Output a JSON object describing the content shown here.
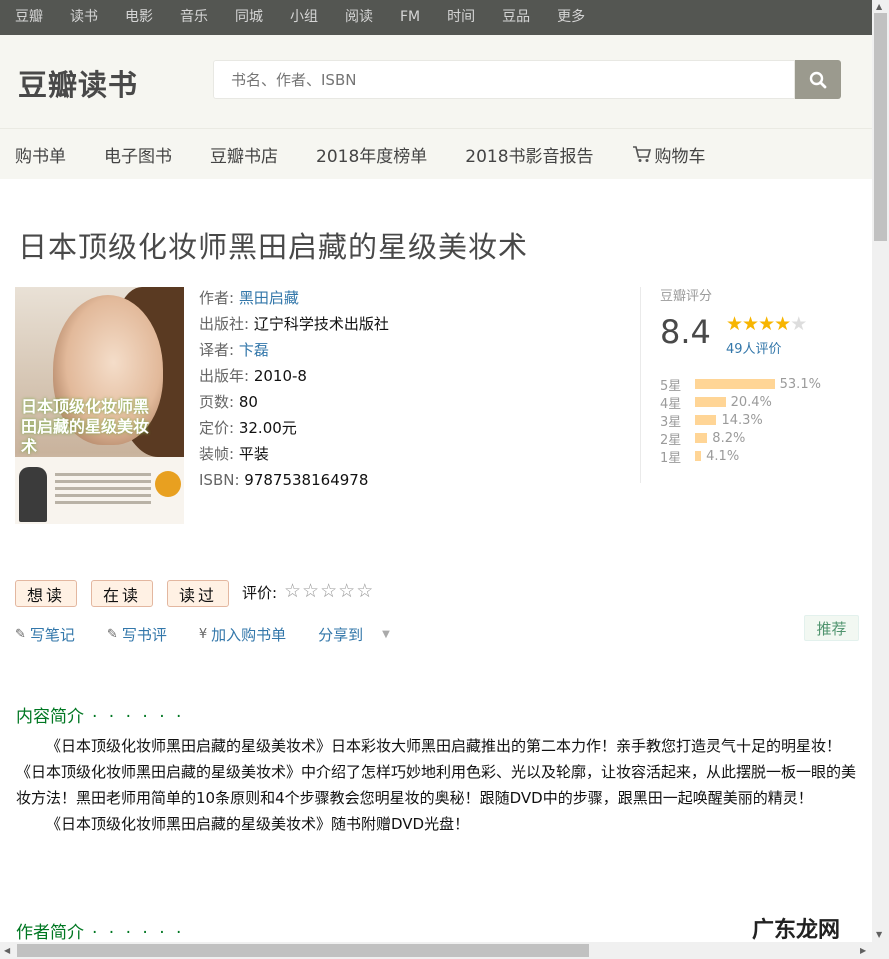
{
  "topnav": [
    "豆瓣",
    "读书",
    "电影",
    "音乐",
    "同城",
    "小组",
    "阅读",
    "FM",
    "时间",
    "豆品",
    "更多"
  ],
  "logo": "豆瓣读书",
  "search": {
    "placeholder": "书名、作者、ISBN"
  },
  "subnav": [
    "购书单",
    "电子图书",
    "豆瓣书店",
    "2018年度榜单",
    "2018书影音报告",
    "购物车"
  ],
  "book": {
    "title": "日本顶级化妆师黑田启藏的星级美妆术",
    "cover_title": "日本顶级化妆师黑田启藏的星级美妆术",
    "author_label": "作者:",
    "author": "黑田启藏",
    "publisher_label": "出版社:",
    "publisher": "辽宁科学技术出版社",
    "translator_label": "译者:",
    "translator": "卞磊",
    "year_label": "出版年:",
    "year": "2010-8",
    "pages_label": "页数:",
    "pages": "80",
    "price_label": "定价:",
    "price": "32.00元",
    "binding_label": "装帧:",
    "binding": "平装",
    "isbn_label": "ISBN:",
    "isbn": "9787538164978"
  },
  "rating": {
    "title": "豆瓣评分",
    "score": "8.4",
    "stars": 4,
    "count": "49人评价",
    "breakdown": [
      {
        "label": "5星",
        "percent": 53.1,
        "text": "53.1%"
      },
      {
        "label": "4星",
        "percent": 20.4,
        "text": "20.4%"
      },
      {
        "label": "3星",
        "percent": 14.3,
        "text": "14.3%"
      },
      {
        "label": "2星",
        "percent": 8.2,
        "text": "8.2%"
      },
      {
        "label": "1星",
        "percent": 4.1,
        "text": "4.1%"
      }
    ]
  },
  "buttons": {
    "want": "想读",
    "reading": "在读",
    "read": "读过",
    "rate_label": "评价:"
  },
  "actions": {
    "note": "写笔记",
    "review": "写书评",
    "cart": "加入购书单",
    "share": "分享到",
    "recommend": "推荐"
  },
  "intro": {
    "heading": "内容简介",
    "dots": "· · · · · ·",
    "p1": "《日本顶级化妆师黑田启藏的星级美妆术》日本彩妆大师黑田启藏推出的第二本力作！亲手教您打造灵气十足的明星妆！《日本顶级化妆师黑田启藏的星级美妆术》中介绍了怎样巧妙地利用色彩、光以及轮廓，让妆容活起来，从此摆脱一板一眼的美妆方法！黑田老师用简单的10条原则和4个步骤教会您明星妆的奥秘！跟随DVD中的步骤，跟黑田一起唤醒美丽的精灵！",
    "p2": "《日本顶级化妆师黑田启藏的星级美妆术》随书附赠DVD光盘！"
  },
  "author_section": {
    "heading": "作者简介",
    "dots": "· · · · · ·"
  },
  "watermark": "广东龙网",
  "colors": {
    "link": "#3377aa",
    "green": "#007722",
    "star": "#f7b500",
    "bar": "#ffd596"
  }
}
